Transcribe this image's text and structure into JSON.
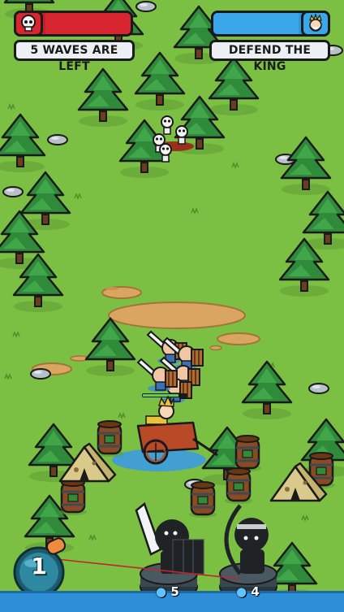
{
  "hud": {
    "enemy_icon": "skull-icon",
    "king_icon": "king-face-icon",
    "enemy_color": "#d7262f",
    "king_color": "#3ba7ea",
    "waves_label": "5 WAVES ARE LEFT",
    "objective_label": "DEFEND THE KING"
  },
  "units": [
    {
      "name": "swordsman-shield",
      "icon": "swordsman-icon",
      "cost": "5",
      "currency_icon": "water-drop-icon"
    },
    {
      "name": "archer",
      "icon": "archer-icon",
      "cost": "4",
      "currency_icon": "water-drop-icon"
    }
  ],
  "bomb": {
    "icon": "bomb-icon",
    "count": "1"
  }
}
